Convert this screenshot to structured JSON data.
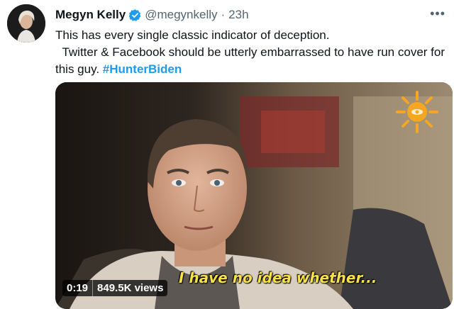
{
  "author": {
    "name": "Megyn Kelly",
    "handle": "@megynkelly",
    "separator": "·",
    "time": "23h"
  },
  "tweet": {
    "line1": "This has every single classic indicator of deception.",
    "line2": "  Twitter & Facebook should be utterly embarrassed to have run cover for",
    "line3_prefix": "this guy. ",
    "hashtag": "#HunterBiden"
  },
  "video": {
    "caption": "I have no idea whether...",
    "duration": "0:19",
    "views": "849.5K views"
  },
  "icons": {
    "verified": "verified-badge-icon",
    "more": "more-options-icon",
    "logo": "cbs-sunday-morning-sun-logo"
  },
  "colors": {
    "accent": "#1d9bf0",
    "text": "#0f1419",
    "secondary": "#536471",
    "caption": "#f7e04a"
  }
}
